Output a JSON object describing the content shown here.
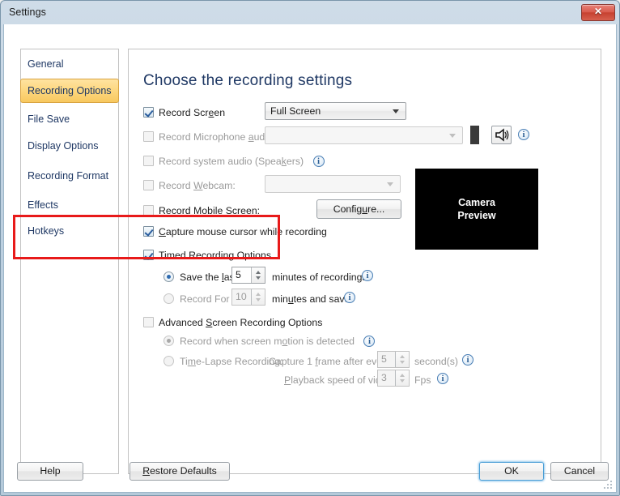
{
  "window": {
    "title": "Settings",
    "close_label": "✕"
  },
  "sidebar": {
    "items": [
      {
        "label": "General",
        "active": false
      },
      {
        "label": "Recording Options",
        "active": true
      },
      {
        "label": "File Save",
        "active": false
      },
      {
        "label": "Display Options",
        "active": false
      },
      {
        "label": "Recording Format",
        "active": false
      },
      {
        "label": "Effects",
        "active": false
      },
      {
        "label": "Hotkeys",
        "active": false
      }
    ]
  },
  "content": {
    "heading": "Choose the recording settings",
    "record_screen": {
      "label_pre": "Record Scr",
      "label_accel": "e",
      "label_post": "en",
      "checked": true,
      "dropdown_value": "Full Screen"
    },
    "record_microphone": {
      "label_pre": "Record Microphone ",
      "label_accel": "a",
      "label_post": "udio",
      "checked": false,
      "enabled": false,
      "dropdown_value": ""
    },
    "record_system_audio": {
      "label_pre": "Record system audio (Spea",
      "label_accel": "k",
      "label_post": "ers)",
      "checked": false,
      "enabled": false
    },
    "record_webcam": {
      "label_pre": "Record ",
      "label_accel": "W",
      "label_post": "ebcam:",
      "checked": false,
      "enabled": false,
      "dropdown_value": ""
    },
    "record_mobile_screen": {
      "label_pre": "Record Mobile Scr",
      "label_accel": "e",
      "label_post": "en:",
      "checked": false,
      "configure_button": "Configure..."
    },
    "capture_cursor": {
      "label_pre": "",
      "label_accel": "C",
      "label_post": "apture mouse cursor while recording",
      "checked": true
    },
    "timed_recording": {
      "label": "Timed Recording Options",
      "checked": true,
      "save_last": {
        "label_pre": "Save the ",
        "label_accel": "l",
        "label_post": "ast",
        "selected": true,
        "value": "5",
        "suffix": "minutes of recordings"
      },
      "record_for": {
        "label": "Record For",
        "selected": false,
        "value": "10",
        "suffix_pre": "min",
        "suffix_accel": "u",
        "suffix_post": "tes and save"
      }
    },
    "advanced": {
      "label_pre": "Advanced ",
      "label_accel": "S",
      "label_post": "creen Recording Options",
      "checked": false,
      "motion_detect": {
        "label_pre": "Record when screen m",
        "label_accel": "o",
        "label_post": "tion is detected",
        "selected": true,
        "enabled": false
      },
      "time_lapse": {
        "label_pre": "Ti",
        "label_accel": "m",
        "label_post": "e-Lapse Recording:",
        "selected": false,
        "enabled": false,
        "capture_label_pre": "Capture 1 ",
        "capture_label_accel": "f",
        "capture_label_post": "rame after every",
        "capture_value": "5",
        "capture_unit": "second(s)",
        "playback_label_pre": "",
        "playback_label_accel": "P",
        "playback_label_post": "layback speed of video:",
        "playback_value": "3",
        "playback_unit": "Fps"
      }
    },
    "camera_preview": {
      "line1": "Camera",
      "line2": "Preview"
    }
  },
  "footer": {
    "help": "Help",
    "restore_defaults_pre": "",
    "restore_defaults_accel": "R",
    "restore_defaults_post": "estore Defaults",
    "ok": "OK",
    "cancel": "Cancel"
  },
  "colors": {
    "accent_heading": "#1f3864",
    "highlight_red": "#e81a1a",
    "selected_item": "#f8c95f"
  }
}
